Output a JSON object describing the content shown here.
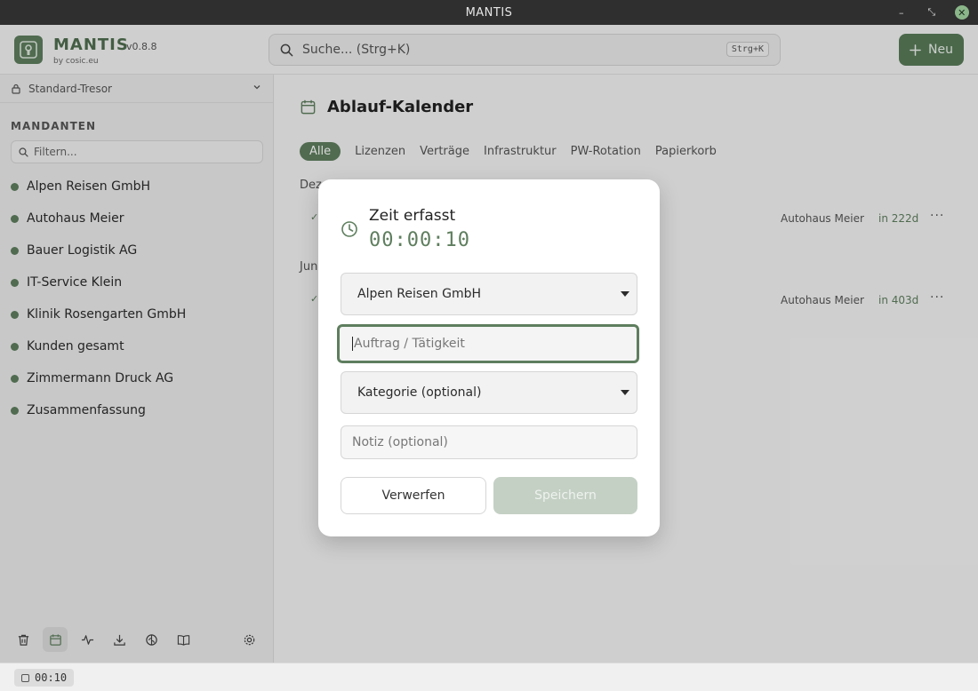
{
  "window": {
    "title": "MANTIS",
    "minimize": "–",
    "restore": "⤡",
    "close": "✕"
  },
  "header": {
    "brand": "MANTIS",
    "version": "v0.8.8",
    "byline": "by cosic.eu",
    "search_placeholder": "Suche... (Strg+K)",
    "search_shortcut": "Strg+K",
    "new_label": "Neu"
  },
  "sidebar": {
    "vault": "Standard-Tresor",
    "section_title": "MANDANTEN",
    "filter_placeholder": "Filtern...",
    "clients": [
      "Alpen Reisen GmbH",
      "Autohaus Meier",
      "Bauer Logistik AG",
      "IT-Service Klein",
      "Klinik Rosengarten GmbH",
      "Kunden gesamt",
      "Zimmermann Druck AG",
      "Zusammenfassung"
    ]
  },
  "main": {
    "title": "Ablauf-Kalender",
    "tabs": [
      "Alle",
      "Lizenzen",
      "Verträge",
      "Infrastruktur",
      "PW-Rotation",
      "Papierkorb"
    ],
    "groups": [
      {
        "label": "Dez",
        "client": "Autohaus Meier",
        "due": "in 222d"
      },
      {
        "label": "Jun",
        "client": "Autohaus Meier",
        "due": "in 403d"
      }
    ]
  },
  "modal": {
    "title": "Zeit erfasst",
    "timer": "00:00:10",
    "client_value": "Alpen Reisen GmbH",
    "task_placeholder": "Auftrag / Tätigkeit",
    "category_value": "Kategorie (optional)",
    "note_placeholder": "Notiz (optional)",
    "discard_label": "Verwerfen",
    "save_label": "Speichern"
  },
  "statusbar": {
    "timer": "00:10"
  },
  "colors": {
    "accent": "#5e7e5e",
    "titlebar": "#2f2f2f",
    "save_disabled": "#c4d0c4"
  }
}
